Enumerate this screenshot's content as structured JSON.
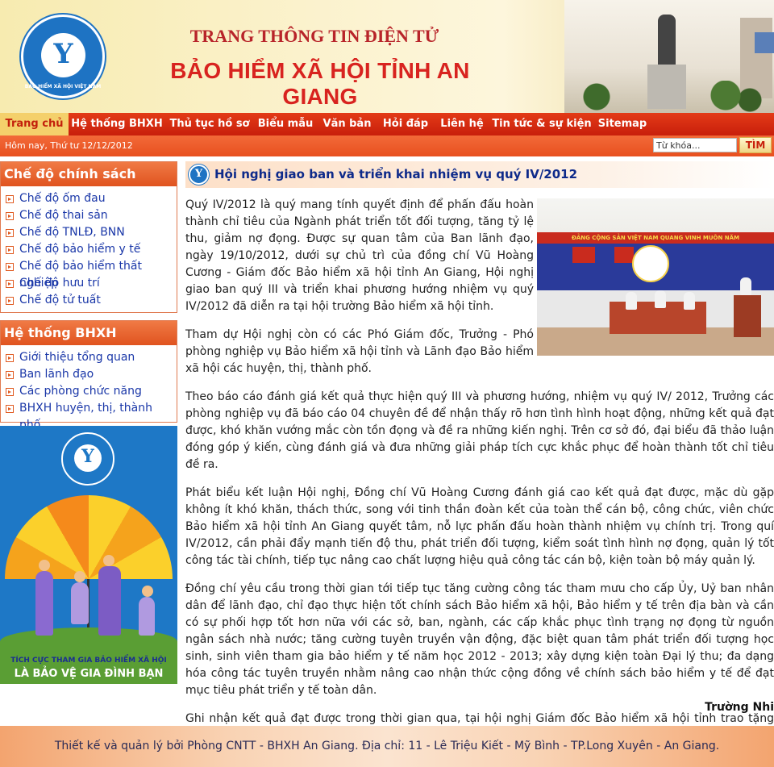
{
  "header": {
    "logo_ring_text": "BẢO HIỂM XÃ HỘI VIỆT NAM",
    "title_line1": "TRANG THÔNG TIN ĐIỆN TỬ",
    "title_line2": "BẢO HIỂM XÃ HỘI TỈNH AN GIANG"
  },
  "nav": {
    "items": [
      {
        "label": "Trang chủ",
        "active": true
      },
      {
        "label": "Hệ thống BHXH"
      },
      {
        "label": "Thủ tục hồ sơ"
      },
      {
        "label": "Biểu mẫu"
      },
      {
        "label": "Văn bản"
      },
      {
        "label": "Hỏi đáp"
      },
      {
        "label": "Liên hệ"
      },
      {
        "label": "Tin tức & sự kiện"
      },
      {
        "label": "Sitemap"
      }
    ]
  },
  "datebar": {
    "date": "Hôm nay, Thứ tư 12/12/2012",
    "search_value": "Từ khóa...",
    "search_button": "TÌM"
  },
  "sidebar": {
    "policies": {
      "title": "Chế độ chính sách",
      "items": [
        "Chế độ ốm đau",
        "Chế độ thai sản",
        "Chế độ TNLĐ, BNN",
        "Chế độ bảo hiểm y tế",
        "Chế độ bảo hiểm thất nghiệp",
        "Chế độ hưu trí",
        "Chế độ tử tuất"
      ]
    },
    "system": {
      "title": "Hệ thống BHXH",
      "items": [
        "Giới thiệu tổng quan",
        "Ban lãnh đạo",
        "Các phòng chức năng",
        "BHXH huyện, thị, thành phố"
      ]
    },
    "banner": {
      "line1": "TÍCH CỰC THAM GIA BẢO HIỂM XÃ HỘI",
      "line2": "LÀ BẢO VỆ GIA ĐÌNH BẠN"
    }
  },
  "article": {
    "title": "Hội nghị giao ban và triển khai nhiệm vụ quý IV/2012",
    "photo_banner": "ĐẢNG CỘNG SẢN VIỆT NAM QUANG VINH MUÔN NĂM",
    "paragraphs": [
      "Quý IV/2012 là quý mang tính quyết định để phấn đấu hoàn thành chỉ tiêu của Ngành phát triển tốt đối tượng, tăng tỷ lệ thu, giảm nợ đọng. Được sự quan tâm của Ban lãnh đạo, ngày 19/10/2012, dưới sự chủ trì của đồng chí Vũ Hoàng Cương - Giám đốc Bảo hiểm xã hội tỉnh An Giang, Hội nghị giao ban quý III và triển khai phương hướng nhiệm vụ quý IV/2012 đã diễn ra tại hội trường Bảo hiểm xã hội tỉnh.",
      "Tham dự Hội nghị còn có các Phó Giám đốc, Trưởng - Phó phòng nghiệp vụ Bảo hiểm xã hội tỉnh và Lãnh đạo Bảo hiểm xã hội các huyện, thị, thành phố.",
      "Theo báo cáo đánh giá kết quả thực hiện quý III và phương hướng, nhiệm vụ quý IV/ 2012, Trưởng các phòng nghiệp vụ đã báo cáo 04 chuyên đề để nhận thấy rõ hơn tình hình hoạt động, những kết quả đạt được, khó khăn vướng mắc còn tồn đọng và đề ra những kiến nghị. Trên cơ sở đó, đại biểu đã thảo luận đóng góp ý kiến, cùng đánh giá và đưa những giải pháp tích cực khắc phục để hoàn thành tốt chỉ tiêu đề ra.",
      "Phát biểu kết luận Hội nghị, Đồng chí Vũ Hoàng Cương đánh giá cao kết quả đạt được, mặc dù gặp không ít khó khăn, thách thức, song với tinh thần đoàn kết của toàn thể cán bộ, công chức, viên chức Bảo hiểm xã hội tỉnh An Giang quyết tâm, nỗ lực phấn đấu hoàn thành nhiệm vụ chính trị. Trong quí IV/2012, cần phải đẩy mạnh tiến độ thu, phát triển đối tượng, kiểm soát tình hình nợ đọng, quản lý tốt công tác tài chính, tiếp tục nâng cao chất lượng hiệu quả công tác cán bộ, kiện toàn bộ máy quản lý.",
      "Đồng chí yêu cầu trong thời gian tới tiếp tục tăng cường công tác tham mưu cho cấp Ủy, Uỷ ban nhân dân để lãnh đạo, chỉ đạo thực hiện tốt chính sách Bảo hiểm xã hội, Bảo hiểm y tế trên địa bàn và cần có sự phối hợp tốt hơn nữa với các sở, ban, ngành, các cấp khắc phục tình trạng nợ đọng từ nguồn ngân sách nhà nước; tăng cường tuyên truyền vận động, đặc biệt quan tâm phát triển đối tượng học sinh, sinh viên tham gia bảo hiểm y tế năm học 2012 - 2013; xây dựng kiện toàn Đại lý thu; đa dạng hóa công tác tuyên truyền nhằm nâng cao nhận thức cộng đồng về chính sách bảo hiểm y tế để đạt mục tiêu phát triển y tế toàn dân.",
      "Ghi nhận kết quả đạt được trong thời gian qua, tại hội nghị Giám đốc Bảo hiểm xã hội tỉnh trao tặng giấy khen cho các đơn vị hoàn thành tốt chỉ tiêu thu Bảo hiểm xã hội, Bảo hiểm thất nghiệp, Bảo hiểm y tế. Đây là món quà ý nghĩa động viên tinh thần để các đơn vị cùng nhau phấn đấu hoàn thành chỉ tiêu của Ngành năm 2012."
    ],
    "author": "Trường Nhi"
  },
  "footer": {
    "text": "Thiết kế và quản lý bởi Phòng CNTT - BHXH An Giang. Địa chỉ: 11 - Lê Triệu Kiết - Mỹ Bình - TP.Long Xuyên - An Giang."
  }
}
